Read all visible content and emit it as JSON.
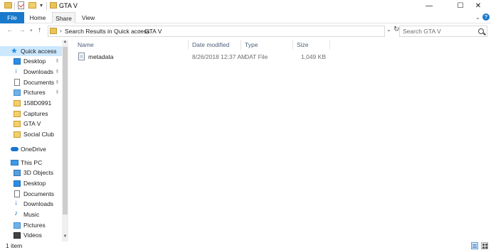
{
  "window": {
    "title": "GTA V",
    "qat_dropdown_glyph": "▾",
    "min_glyph": "—",
    "max_glyph": "☐",
    "close_glyph": "✕"
  },
  "ribbon": {
    "tabs": [
      {
        "label": "File"
      },
      {
        "label": "Home"
      },
      {
        "label": "Share"
      },
      {
        "label": "View"
      }
    ],
    "expand_glyph": "⌄",
    "help_glyph": "?"
  },
  "nav": {
    "back_glyph": "←",
    "forward_glyph": "→",
    "recent_glyph": "▾",
    "up_glyph": "↑",
    "breadcrumb": [
      "Search Results in Quick access",
      "GTA V"
    ],
    "separator_glyph": "›",
    "dropdown_glyph": "⌄",
    "refresh_glyph": "↻",
    "search_placeholder": "Search GTA V"
  },
  "sidebar": {
    "items": [
      {
        "label": "Quick access",
        "icon": "star-icon",
        "pinned": false,
        "selected": true
      },
      {
        "label": "Desktop",
        "icon": "desktop-icon",
        "pinned": true
      },
      {
        "label": "Downloads",
        "icon": "download-icon",
        "pinned": true
      },
      {
        "label": "Documents",
        "icon": "documents-icon",
        "pinned": true
      },
      {
        "label": "Pictures",
        "icon": "pictures-icon",
        "pinned": true
      },
      {
        "label": "158D0991",
        "icon": "folder-icon"
      },
      {
        "label": "Captures",
        "icon": "folder-icon"
      },
      {
        "label": "GTA V",
        "icon": "folder-icon"
      },
      {
        "label": "Social Club",
        "icon": "folder-icon"
      },
      {
        "label": "OneDrive",
        "icon": "onedrive-icon"
      },
      {
        "label": "This PC",
        "icon": "pc-icon"
      },
      {
        "label": "3D Objects",
        "icon": "3d-objects-icon"
      },
      {
        "label": "Desktop",
        "icon": "desktop-icon"
      },
      {
        "label": "Documents",
        "icon": "documents-icon"
      },
      {
        "label": "Downloads",
        "icon": "download-icon"
      },
      {
        "label": "Music",
        "icon": "music-icon"
      },
      {
        "label": "Pictures",
        "icon": "pictures-icon"
      },
      {
        "label": "Videos",
        "icon": "videos-icon"
      }
    ],
    "pin_glyph": "📌",
    "scroll_up_glyph": "▲",
    "scroll_down_glyph": "▼"
  },
  "file_list": {
    "columns": [
      "Name",
      "Date modified",
      "Type",
      "Size"
    ],
    "rows": [
      {
        "name": "metadata",
        "date_modified": "8/26/2018 12:37 AM",
        "type": "DAT File",
        "size": "1,049 KB"
      }
    ]
  },
  "status": {
    "item_count": "1 item"
  }
}
